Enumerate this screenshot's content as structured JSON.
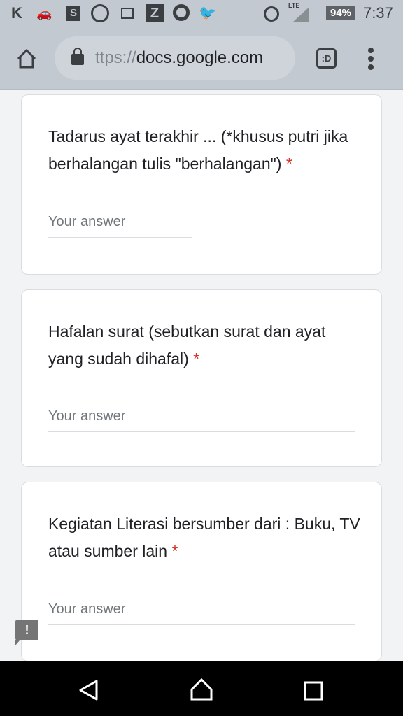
{
  "status_bar": {
    "battery": "94%",
    "time": "7:37",
    "network": "LTE",
    "icons": [
      "kaskus-icon",
      "car-icon",
      "shopee-icon",
      "whatsapp-icon",
      "image-icon",
      "z-icon",
      "gojek-icon",
      "twitter-icon",
      "alarm-icon",
      "signal-icon",
      "battery-icon"
    ]
  },
  "browser": {
    "url_scheme": "ttps://",
    "url_host": "docs.google.com",
    "tab_switcher": ":D"
  },
  "questions": [
    {
      "title": "Tadarus ayat terakhir ... (*khusus putri jika berhalangan tulis \"berhalangan\")",
      "required": "*",
      "placeholder": "Your answer"
    },
    {
      "title": "Hafalan surat (sebutkan surat dan ayat yang sudah dihafal)",
      "required": "*",
      "placeholder": "Your answer"
    },
    {
      "title": "Kegiatan Literasi bersumber dari : Buku, TV atau sumber lain",
      "required": "*",
      "placeholder": "Your answer"
    }
  ],
  "feedback": "!",
  "colors": {
    "required": "#d93025",
    "page_bg": "#f1f3f4",
    "chrome_bg": "#c3c9d0"
  }
}
